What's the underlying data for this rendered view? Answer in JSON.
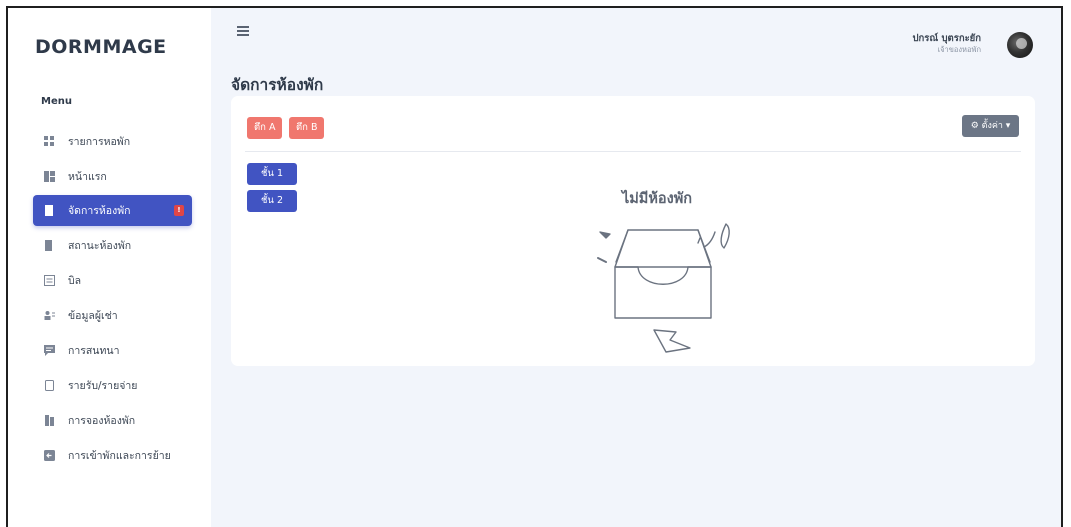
{
  "sidebar": {
    "brand": "DORMMAGE",
    "menu_heading": "Menu",
    "items": [
      {
        "label": "รายการหอพัก",
        "icon": "grid-icon"
      },
      {
        "label": "หน้าแรก",
        "icon": "dashboard-icon"
      },
      {
        "label": "จัดการห้องพัก",
        "icon": "door-icon",
        "active": true,
        "badge": "!"
      },
      {
        "label": "สถานะห้องพัก",
        "icon": "door-status-icon"
      },
      {
        "label": "บิล",
        "icon": "bill-icon"
      },
      {
        "label": "ข้อมูลผู้เช่า",
        "icon": "tenants-icon"
      },
      {
        "label": "การสนทนา",
        "icon": "chat-icon"
      },
      {
        "label": "รายรับ/รายจ่าย",
        "icon": "receipt-icon"
      },
      {
        "label": "การจองห้องพัก",
        "icon": "booking-icon"
      },
      {
        "label": "การเข้าพักและการย้าย",
        "icon": "move-in-icon"
      }
    ]
  },
  "header": {
    "user_name": "ปกรณ์ บุตรกะยัก",
    "user_role": "เจ้าของหอพัก"
  },
  "main": {
    "title": "จัดการห้องพัก",
    "buildings": [
      "ตึก A",
      "ตึก B"
    ],
    "settings_label": "⚙ ตั้งค่า ▾",
    "floors": [
      "ชั้น 1",
      "ชั้น 2"
    ],
    "empty_text": "ไม่มีห้องพัก"
  },
  "colors": {
    "primary": "#4154c2",
    "building_button": "#f0776e",
    "settings_button": "#6c7686",
    "badge": "#e04646",
    "background": "#f2f5fb"
  }
}
